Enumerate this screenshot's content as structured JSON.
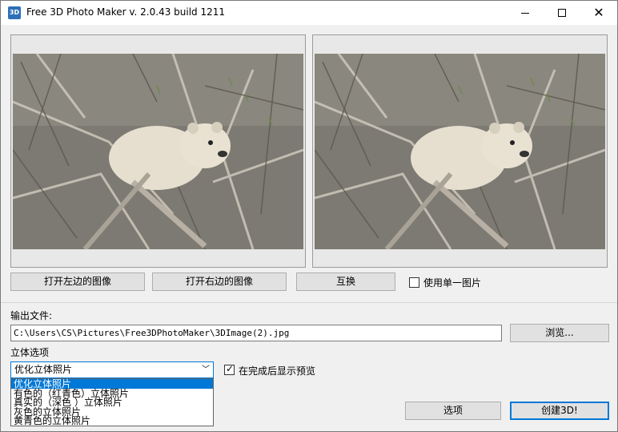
{
  "window": {
    "title": "Free 3D Photo Maker  v. 2.0.43 build 1211",
    "icon_text": "3D"
  },
  "buttons": {
    "open_left": "打开左边的图像",
    "open_right": "打开右边的图像",
    "swap": "互换",
    "browse": "浏览...",
    "options": "选项",
    "create": "创建3D!"
  },
  "single_image": {
    "label": "使用单一图片",
    "checked": false
  },
  "output": {
    "label": "输出文件:",
    "path": "C:\\Users\\CS\\Pictures\\Free3DPhotoMaker\\3DImage(2).jpg"
  },
  "stereo": {
    "label": "立体选项",
    "selected": "优化立体照片",
    "options": [
      "优化立体照片",
      "有色的（红青色）立体照片",
      "真实的（深色 ）立体照片",
      "灰色的立体照片",
      "黄青色的立体照片"
    ]
  },
  "preview_after": {
    "label": "在完成后显示预览",
    "checked": true
  }
}
